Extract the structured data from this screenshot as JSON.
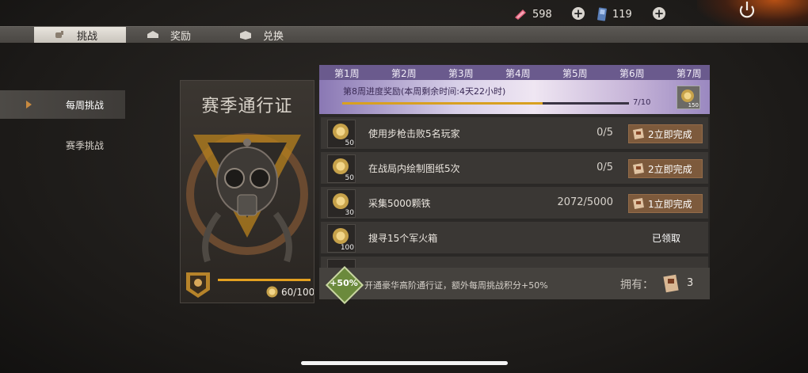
{
  "currencies": [
    {
      "icon": "pink-crystal-icon",
      "value": "598"
    },
    {
      "icon": "blue-card-icon",
      "value": "119"
    }
  ],
  "tabs": [
    {
      "label": "挑战",
      "active": true
    },
    {
      "label": "奖励",
      "active": false
    },
    {
      "label": "兑换",
      "active": false
    }
  ],
  "sidebar": [
    {
      "label": "每周挑战",
      "active": true
    },
    {
      "label": "赛季挑战",
      "active": false
    }
  ],
  "season_pass": {
    "title": "赛季通行证",
    "points": "60/100",
    "progress": 0.6
  },
  "weeks": [
    "第1周",
    "第2周",
    "第3周",
    "第4周",
    "第5周",
    "第6周",
    "第7周"
  ],
  "weekly_progress": {
    "label": "第8周进度奖励(本周剩余时间:4天22小时)",
    "count": "7/10",
    "fraction": 0.7,
    "reward_points": "150"
  },
  "challenges": [
    {
      "points": "50",
      "description": "使用步枪击败5名玩家",
      "progress": "0/5",
      "button": "2立即完成",
      "claimed": null
    },
    {
      "points": "50",
      "description": "在战局内绘制图纸5次",
      "progress": "0/5",
      "button": "2立即完成",
      "claimed": null
    },
    {
      "points": "30",
      "description": "采集5000颗铁",
      "progress": "2072/5000",
      "button": "1立即完成",
      "claimed": null
    },
    {
      "points": "100",
      "description": "搜寻15个军火箱",
      "progress": "",
      "button": null,
      "claimed": "已领取"
    }
  ],
  "footer": {
    "badge": "+50%",
    "text": "开通豪华高阶通行证，额外每周挑战积分+50%",
    "own_label": "拥有：",
    "own_count": "3"
  },
  "colors": {
    "accent": "#e3a020",
    "week_bar": "#6a5a8d",
    "button": "#7d5a3c",
    "badge": "#6b8a3c"
  }
}
